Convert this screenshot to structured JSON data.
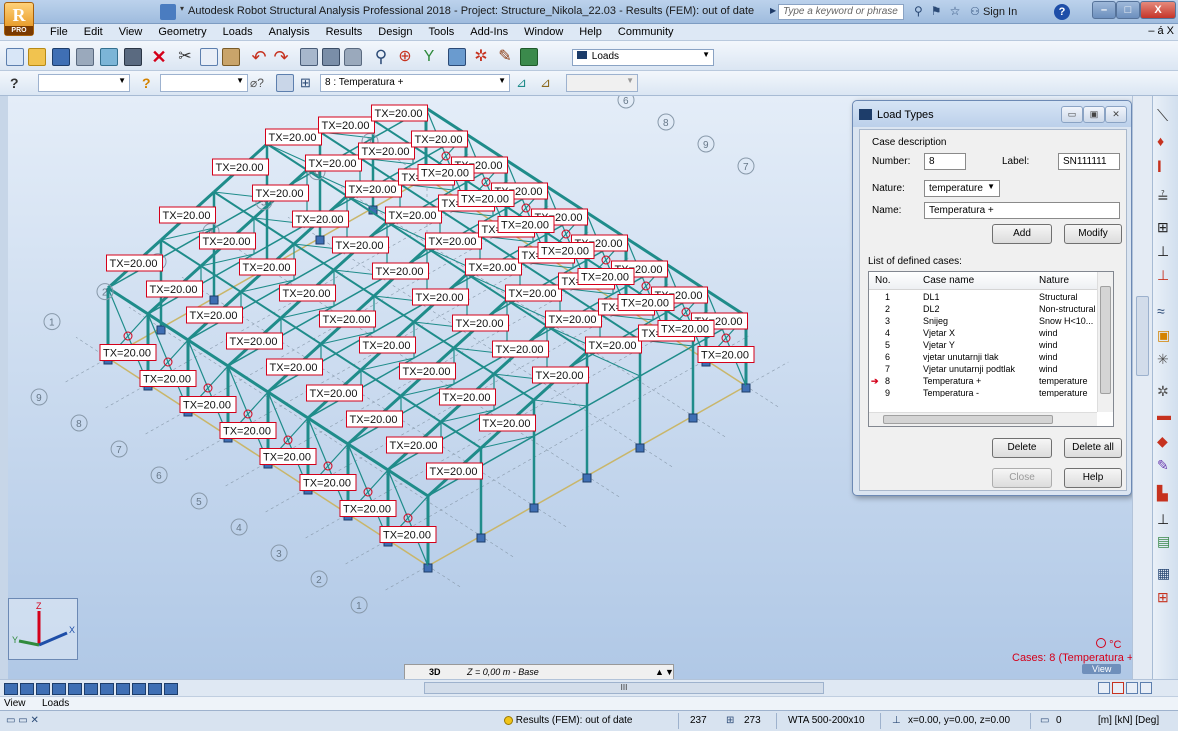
{
  "titlebar": {
    "app_letter": "R",
    "app_badge": "PRO",
    "title": "Autodesk Robot Structural Analysis Professional 2018 - Project: Structure_Nikola_22.03 - Results (FEM): out of date",
    "search_placeholder": "Type a keyword or phrase",
    "sign_in": "Sign In",
    "help": "?",
    "min": "–",
    "max": "□",
    "close": "X"
  },
  "menu": {
    "items": [
      "File",
      "Edit",
      "View",
      "Geometry",
      "Loads",
      "Analysis",
      "Results",
      "Design",
      "Tools",
      "Add-Ins",
      "Window",
      "Help",
      "Community"
    ],
    "doc_controls": "– á X"
  },
  "toolbar1": {
    "loads_combo": "Loads"
  },
  "toolbar2": {
    "case_combo": "8 : Temperatura +"
  },
  "viewport": {
    "load_label": "TX=20.00",
    "axis_labels": {
      "x": "X",
      "y": "Y",
      "z": "Z"
    },
    "node_labels": [
      "7",
      "9",
      "8",
      "6",
      "5",
      "4",
      "3",
      "2",
      "1"
    ],
    "nav_mode": "3D",
    "level": "Z = 0,00 m - Base",
    "legend_unit": "°C",
    "legend_cases": "Cases: 8 (Temperatura +)",
    "view_button": "View"
  },
  "dialog": {
    "title": "Load Types",
    "case_description": "Case description",
    "number_label": "Number:",
    "number_value": "8",
    "label_label": "Label:",
    "label_value": "SN111111",
    "nature_label": "Nature:",
    "nature_value": "temperature",
    "name_label": "Name:",
    "name_value": "Temperatura +",
    "add": "Add",
    "modify": "Modify",
    "list_title": "List of defined cases:",
    "columns": [
      "No.",
      "Case name",
      "Nature"
    ],
    "rows": [
      {
        "no": "1",
        "name": "DL1",
        "nature": "Structural"
      },
      {
        "no": "2",
        "name": "DL2",
        "nature": "Non-structural"
      },
      {
        "no": "3",
        "name": "Snijeg",
        "nature": "Snow H<10..."
      },
      {
        "no": "4",
        "name": "Vjetar X",
        "nature": "wind"
      },
      {
        "no": "5",
        "name": "Vjetar Y",
        "nature": "wind"
      },
      {
        "no": "6",
        "name": "vjetar unutarnji tlak",
        "nature": "wind"
      },
      {
        "no": "7",
        "name": "Vjetar unutarnji podtlak",
        "nature": "wind"
      },
      {
        "no": "8",
        "name": "Temperatura +",
        "nature": "temperature"
      },
      {
        "no": "9",
        "name": "Temperatura -",
        "nature": "temperature"
      }
    ],
    "delete": "Delete",
    "delete_all": "Delete all",
    "close": "Close",
    "help": "Help"
  },
  "bottom": {
    "scroll_label": "III",
    "tab_view": "View",
    "tab_loads": "Loads"
  },
  "statusbar": {
    "results": "Results (FEM): out of date",
    "nodes": "237",
    "bars": "273",
    "section": "WTA 500-200x10",
    "coords": "x=0.00, y=0.00, z=0.00",
    "count": "0",
    "units": "[m] [kN] [Deg]"
  },
  "colors": {
    "structure": "#1f8c8a",
    "label_border": "#d4001a",
    "accent": "#1e4ea8"
  }
}
